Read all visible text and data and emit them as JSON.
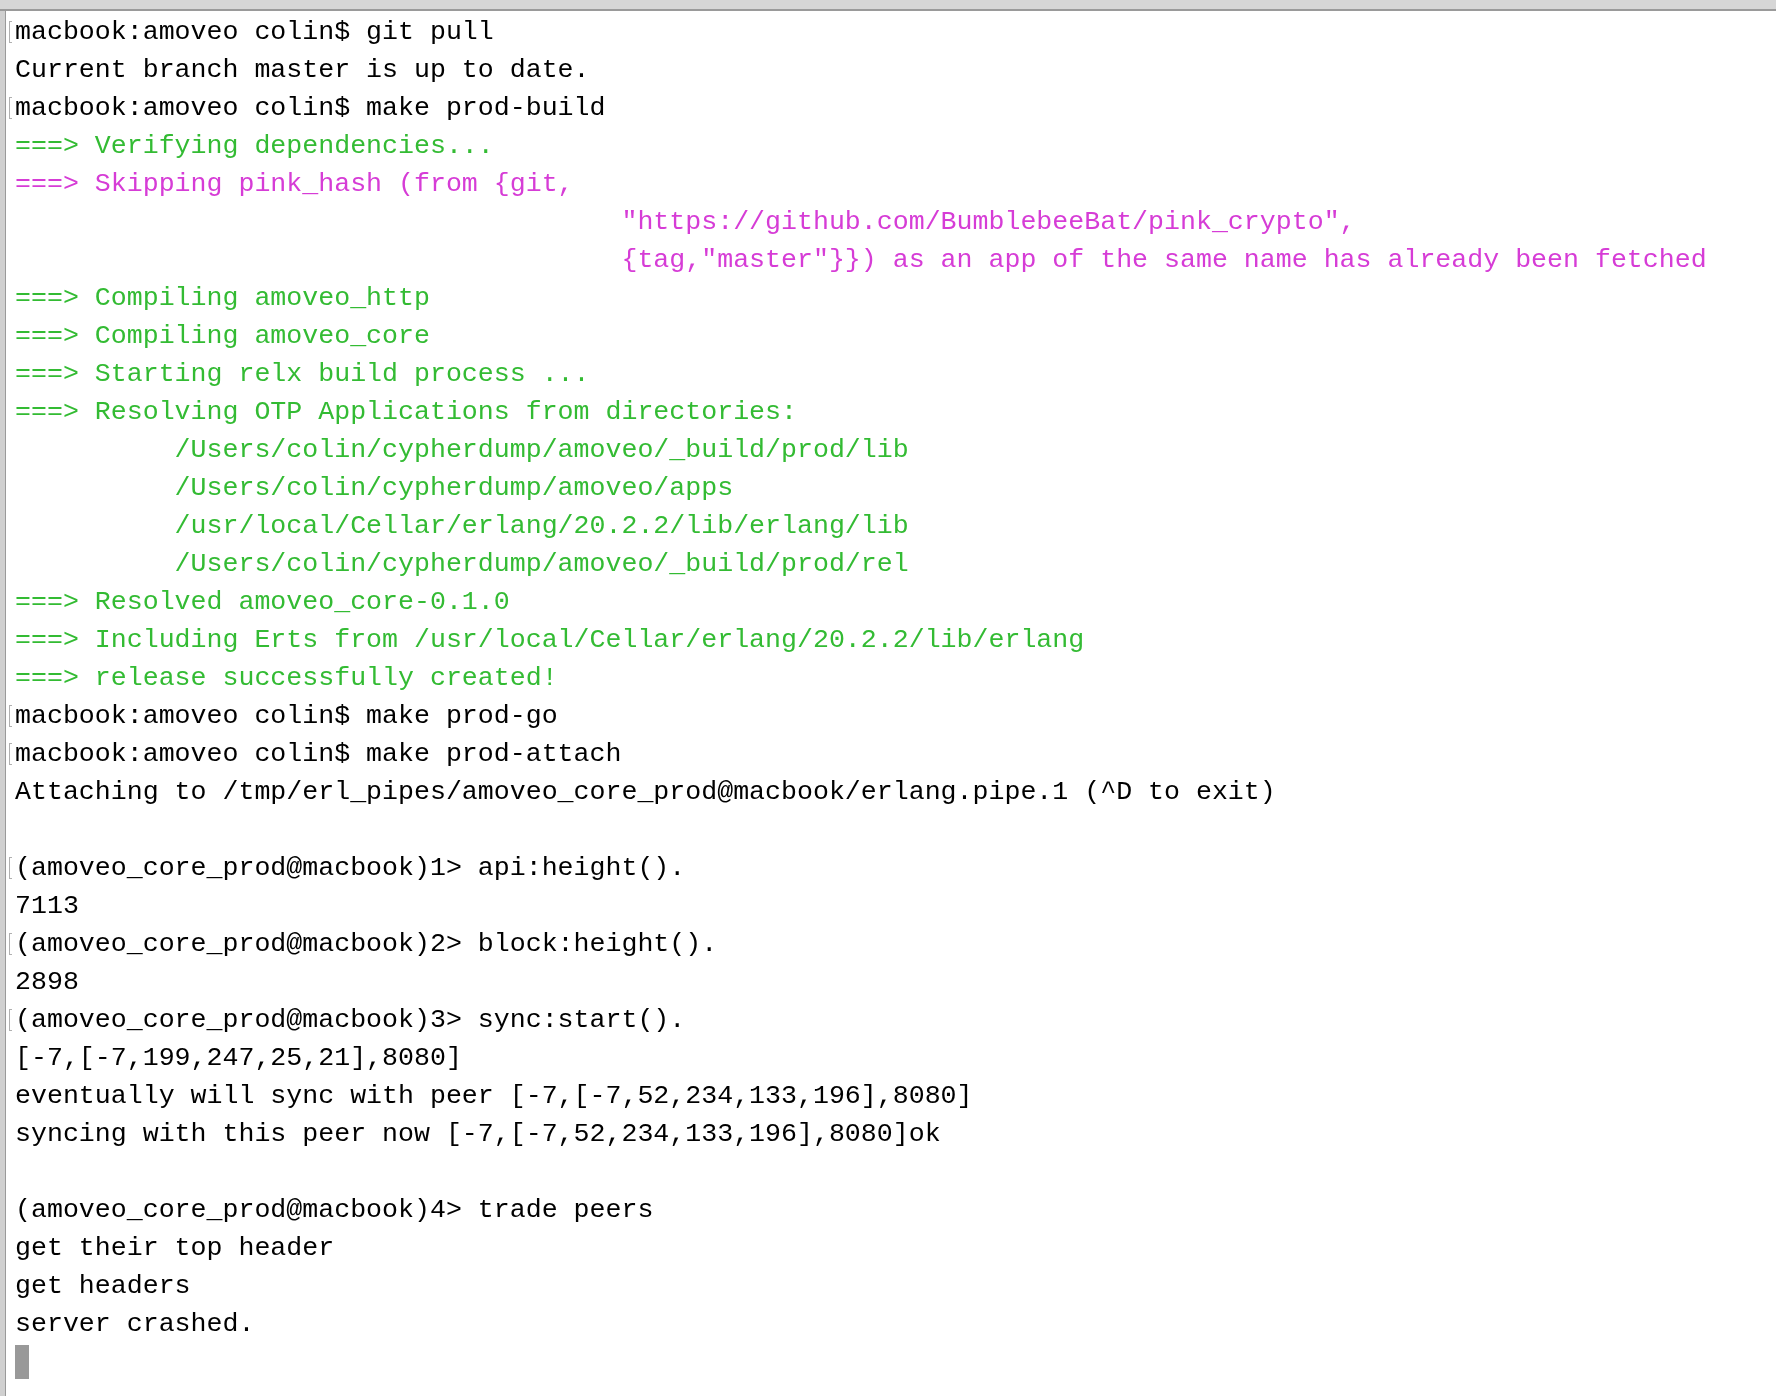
{
  "lines": [
    {
      "kind": "prompt",
      "marked": true,
      "text": "macbook:amoveo colin$ git pull"
    },
    {
      "kind": "output",
      "marked": false,
      "text": "Current branch master is up to date."
    },
    {
      "kind": "prompt",
      "marked": true,
      "text": "macbook:amoveo colin$ make prod-build"
    },
    {
      "kind": "info",
      "marked": false,
      "text": "===> Verifying dependencies..."
    },
    {
      "kind": "warn",
      "marked": false,
      "text": "===> Skipping pink_hash (from {git,"
    },
    {
      "kind": "warn",
      "marked": false,
      "text": "                                      \"https://github.com/BumblebeeBat/pink_crypto\","
    },
    {
      "kind": "warn",
      "marked": false,
      "text": "                                      {tag,\"master\"}}) as an app of the same name has already been fetched"
    },
    {
      "kind": "info",
      "marked": false,
      "text": "===> Compiling amoveo_http"
    },
    {
      "kind": "info",
      "marked": false,
      "text": "===> Compiling amoveo_core"
    },
    {
      "kind": "info",
      "marked": false,
      "text": "===> Starting relx build process ..."
    },
    {
      "kind": "info",
      "marked": false,
      "text": "===> Resolving OTP Applications from directories:"
    },
    {
      "kind": "info",
      "marked": false,
      "text": "          /Users/colin/cypherdump/amoveo/_build/prod/lib"
    },
    {
      "kind": "info",
      "marked": false,
      "text": "          /Users/colin/cypherdump/amoveo/apps"
    },
    {
      "kind": "info",
      "marked": false,
      "text": "          /usr/local/Cellar/erlang/20.2.2/lib/erlang/lib"
    },
    {
      "kind": "info",
      "marked": false,
      "text": "          /Users/colin/cypherdump/amoveo/_build/prod/rel"
    },
    {
      "kind": "info",
      "marked": false,
      "text": "===> Resolved amoveo_core-0.1.0"
    },
    {
      "kind": "info",
      "marked": false,
      "text": "===> Including Erts from /usr/local/Cellar/erlang/20.2.2/lib/erlang"
    },
    {
      "kind": "info",
      "marked": false,
      "text": "===> release successfully created!"
    },
    {
      "kind": "prompt",
      "marked": true,
      "text": "macbook:amoveo colin$ make prod-go"
    },
    {
      "kind": "prompt",
      "marked": true,
      "text": "macbook:amoveo colin$ make prod-attach"
    },
    {
      "kind": "output",
      "marked": false,
      "text": "Attaching to /tmp/erl_pipes/amoveo_core_prod@macbook/erlang.pipe.1 (^D to exit)"
    },
    {
      "kind": "blank"
    },
    {
      "kind": "prompt",
      "marked": true,
      "text": "(amoveo_core_prod@macbook)1> api:height()."
    },
    {
      "kind": "output",
      "marked": false,
      "text": "7113"
    },
    {
      "kind": "prompt",
      "marked": true,
      "text": "(amoveo_core_prod@macbook)2> block:height()."
    },
    {
      "kind": "output",
      "marked": false,
      "text": "2898"
    },
    {
      "kind": "prompt",
      "marked": true,
      "text": "(amoveo_core_prod@macbook)3> sync:start()."
    },
    {
      "kind": "output",
      "marked": false,
      "text": "[-7,[-7,199,247,25,21],8080]"
    },
    {
      "kind": "output",
      "marked": false,
      "text": "eventually will sync with peer [-7,[-7,52,234,133,196],8080]"
    },
    {
      "kind": "output",
      "marked": false,
      "text": "syncing with this peer now [-7,[-7,52,234,133,196],8080]ok"
    },
    {
      "kind": "blank"
    },
    {
      "kind": "prompt",
      "marked": false,
      "text": "(amoveo_core_prod@macbook)4> trade peers"
    },
    {
      "kind": "output",
      "marked": false,
      "text": "get their top header"
    },
    {
      "kind": "output",
      "marked": false,
      "text": "get headers"
    },
    {
      "kind": "output",
      "marked": false,
      "text": "server crashed."
    },
    {
      "kind": "cursor"
    }
  ]
}
